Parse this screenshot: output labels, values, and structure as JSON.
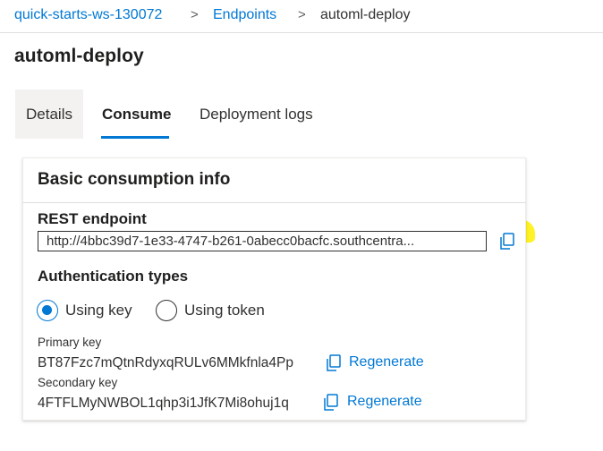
{
  "breadcrumb": {
    "workspace": "quick-starts-ws-130072",
    "endpoints": "Endpoints",
    "current": "automl-deploy",
    "separator": ">"
  },
  "page": {
    "title": "automl-deploy"
  },
  "tabs": [
    {
      "label": "Details",
      "selected": false
    },
    {
      "label": "Consume",
      "selected": true
    },
    {
      "label": "Deployment logs",
      "selected": false
    }
  ],
  "card": {
    "title": "Basic consumption info",
    "rest_endpoint": {
      "label": "REST endpoint",
      "value": "http://4bbc39d7-1e33-4747-b261-0abecc0bacfc.southcentra..."
    },
    "auth": {
      "label": "Authentication types",
      "options": [
        {
          "label": "Using key",
          "selected": true
        },
        {
          "label": "Using token",
          "selected": false
        }
      ]
    },
    "primary_key": {
      "label": "Primary key",
      "value": "BT87Fzc7mQtnRdyxqRULv6MMkfnla4Pp",
      "regenerate": "Regenerate"
    },
    "secondary_key": {
      "label": "Secondary key",
      "value": "4FTFLMyNWBOL1qhp3i1JfK7Mi8ohuj1q",
      "regenerate": "Regenerate"
    }
  },
  "colors": {
    "accent": "#0078d4",
    "highlight": "#fff200",
    "text": "#323130"
  },
  "icons": {
    "copy": "copy-icon",
    "radio": "radio-button"
  }
}
